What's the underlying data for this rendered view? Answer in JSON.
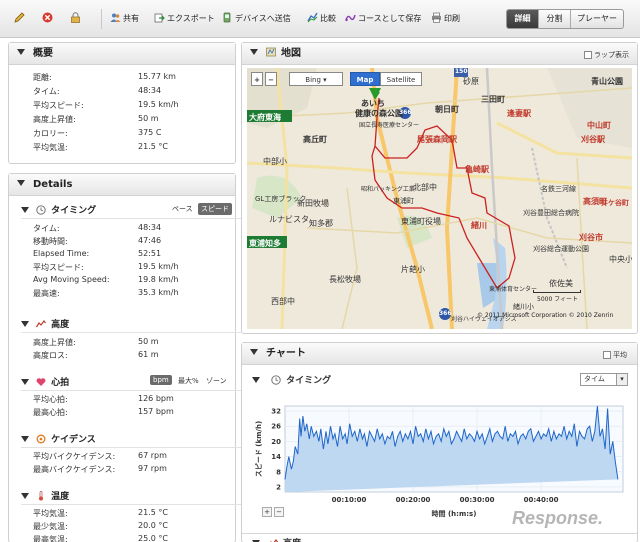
{
  "toolbar": {
    "items": [
      {
        "icon": "pencil-icon",
        "label": ""
      },
      {
        "icon": "delete-icon",
        "label": ""
      },
      {
        "icon": "lock-icon",
        "label": ""
      },
      {
        "icon": "people-icon",
        "label": "共有"
      },
      {
        "icon": "export-icon",
        "label": "エクスポート"
      },
      {
        "icon": "device-send-icon",
        "label": "デバイスへ送信"
      },
      {
        "icon": "compare-icon",
        "label": "比較"
      },
      {
        "icon": "course-save-icon",
        "label": "コースとして保存"
      },
      {
        "icon": "printer-icon",
        "label": "印刷"
      }
    ],
    "views": [
      "詳細",
      "分割",
      "プレーヤー"
    ],
    "active_view": "詳細"
  },
  "summary": {
    "title": "概要",
    "rows": [
      {
        "label": "距離:",
        "value": "15.77 km"
      },
      {
        "label": "タイム:",
        "value": "48:34"
      },
      {
        "label": "平均スピード:",
        "value": "19.5 km/h"
      },
      {
        "label": "高度上昇値:",
        "value": "50 m"
      },
      {
        "label": "カロリー:",
        "value": "375 C"
      },
      {
        "label": "平均気温:",
        "value": "21.5 °C"
      }
    ]
  },
  "details": {
    "title": "Details",
    "timing": {
      "title": "タイミング",
      "options": [
        "ペース",
        "スピード"
      ],
      "selected": "スピード",
      "rows": [
        {
          "label": "タイム:",
          "value": "48:34"
        },
        {
          "label": "移動時間:",
          "value": "47:46"
        },
        {
          "label": "Elapsed Time:",
          "value": "52:51"
        },
        {
          "label": "平均スピード:",
          "value": "19.5 km/h"
        },
        {
          "label": "Avg Moving Speed:",
          "value": "19.8 km/h"
        },
        {
          "label": "最高速:",
          "value": "35.3 km/h"
        }
      ]
    },
    "elevation": {
      "title": "高度",
      "rows": [
        {
          "label": "高度上昇値:",
          "value": "50 m"
        },
        {
          "label": "高度ロス:",
          "value": "61 m"
        }
      ]
    },
    "heart": {
      "title": "心拍",
      "options": [
        "bpm",
        "最大%",
        "ゾーン"
      ],
      "selected": "bpm",
      "rows": [
        {
          "label": "平均心拍:",
          "value": "126 bpm"
        },
        {
          "label": "最高心拍:",
          "value": "157 bpm"
        }
      ]
    },
    "cadence": {
      "title": "ケイデンス",
      "rows": [
        {
          "label": "平均バイクケイデンス:",
          "value": "67 rpm"
        },
        {
          "label": "最高バイクケイデンス:",
          "value": "97 rpm"
        }
      ]
    },
    "temperature": {
      "title": "温度",
      "rows": [
        {
          "label": "平均気温:",
          "value": "21.5 °C"
        },
        {
          "label": "最少気温:",
          "value": "20.0 °C"
        },
        {
          "label": "最高気温:",
          "value": "25.0 °C"
        }
      ]
    }
  },
  "map": {
    "title": "地図",
    "lap_display": "ラップ表示",
    "zoom_in": "+",
    "zoom_out": "−",
    "provider": "Bing",
    "types": [
      "Map",
      "Satellite"
    ],
    "active_type": "Map",
    "scale": "5000 フィート",
    "copyright": "© 2011 Microsoft Corporation   © 2010 Zenrin",
    "labels": [
      {
        "text": "大府東海",
        "color": "#1e7b34"
      },
      {
        "text": "東浦知多",
        "color": "#1e7b34"
      },
      {
        "text": "あいち",
        "color": "#333"
      },
      {
        "text": "健康の森公園",
        "color": "#333"
      },
      {
        "text": "国立長寿医療センター",
        "color": "#333"
      },
      {
        "text": "尾張森岡駅",
        "color": "#c0392b"
      },
      {
        "text": "亀崎駅",
        "color": "#c0392b"
      },
      {
        "text": "逢妻駅",
        "color": "#c0392b"
      },
      {
        "text": "刈谷駅",
        "color": "#c0392b"
      },
      {
        "text": "刈谷市",
        "color": "#c0392b"
      },
      {
        "text": "高須町",
        "color": "#c0392b"
      },
      {
        "text": "井ケ谷町",
        "color": "#c0392b"
      },
      {
        "text": "中山町",
        "color": "#c0392b"
      },
      {
        "text": "青山公園",
        "color": "#333"
      },
      {
        "text": "三田町",
        "color": "#333"
      },
      {
        "text": "砂原",
        "color": "#333"
      },
      {
        "text": "朝日町",
        "color": "#333"
      },
      {
        "text": "高丘町",
        "color": "#333"
      },
      {
        "text": "新田牧場",
        "color": "#333"
      },
      {
        "text": "昭和パッキング工業",
        "color": "#333"
      },
      {
        "text": "東浦町役場",
        "color": "#333"
      },
      {
        "text": "知多郡",
        "color": "#333"
      },
      {
        "text": "長松牧場",
        "color": "#333"
      },
      {
        "text": "西部中",
        "color": "#333"
      },
      {
        "text": "刈谷ハイウェイオアシス",
        "color": "#333"
      },
      {
        "text": "刈谷豊田総合病院",
        "color": "#333"
      },
      {
        "text": "東浦町",
        "color": "#333"
      },
      {
        "text": "緒川",
        "color": "#c0392b"
      },
      {
        "text": "北部中",
        "color": "#333"
      },
      {
        "text": "片葩小",
        "color": "#333"
      },
      {
        "text": "GL工房ブラック",
        "color": "#333"
      },
      {
        "text": "中部小",
        "color": "#333"
      },
      {
        "text": "刈谷総合運動公園",
        "color": "#333"
      },
      {
        "text": "名鉄三河線",
        "color": "#333"
      },
      {
        "text": "依佐美",
        "color": "#333"
      },
      {
        "text": "中央小",
        "color": "#333"
      },
      {
        "text": "東浦体育センター",
        "color": "#333"
      },
      {
        "text": "緒川小",
        "color": "#333"
      },
      {
        "text": "ルナビスタ",
        "color": "#333"
      }
    ],
    "road_numbers": [
      "150",
      "366",
      "366"
    ]
  },
  "chart": {
    "title": "チャート",
    "average_label": "平均",
    "section_title": "タイミング",
    "dropdown_value": "タイム",
    "bottom_section_title": "高度",
    "zoom_in": "+",
    "zoom_out": "−"
  },
  "watermark": "Response.",
  "chart_data": {
    "type": "area",
    "title": "",
    "xlabel": "時間 (h:m:s)",
    "ylabel": "スピード (km/h)",
    "x_ticks": [
      "00:10:00",
      "00:20:00",
      "00:30:00",
      "00:40:00"
    ],
    "y_ticks": [
      2,
      8,
      14,
      20,
      26,
      32
    ],
    "ylim": [
      0,
      34
    ],
    "xlim": [
      0,
      52.8
    ],
    "fill_color": "#bfd8f2",
    "line_color": "#1f66c9",
    "x": [
      0,
      0.3,
      0.6,
      1.0,
      1.3,
      1.6,
      2.0,
      2.3,
      2.5,
      2.8,
      3.1,
      3.4,
      3.8,
      4.1,
      4.5,
      4.9,
      5.3,
      5.6,
      6.0,
      6.4,
      6.7,
      7.1,
      7.5,
      7.8,
      8.2,
      8.6,
      9.0,
      9.4,
      9.7,
      10.1,
      10.5,
      10.9,
      11.3,
      11.7,
      12.1,
      12.4,
      12.8,
      13.2,
      13.6,
      14.0,
      14.4,
      14.8,
      15.2,
      15.6,
      16.0,
      16.4,
      16.8,
      17.2,
      17.6,
      18.0,
      18.4,
      18.8,
      19.2,
      19.6,
      20.0,
      20.4,
      20.8,
      21.2,
      21.6,
      22.0,
      22.4,
      22.8,
      23.2,
      23.6,
      24.0,
      24.4,
      24.8,
      25.2,
      25.6,
      26.0,
      26.4,
      26.8,
      27.2,
      27.6,
      28.0,
      28.4,
      28.8,
      29.2,
      29.6,
      30.0,
      30.4,
      30.8,
      31.2,
      31.6,
      32.0,
      32.4,
      32.8,
      33.2,
      33.6,
      34.0,
      34.4,
      34.8,
      35.2,
      35.6,
      36.0,
      36.4,
      36.8,
      37.2,
      37.6,
      38.0,
      38.4,
      38.8,
      39.2,
      39.6,
      40.0,
      40.4,
      40.8,
      41.2,
      41.6,
      42.0,
      42.4,
      42.8,
      43.2,
      43.6,
      44.0,
      44.4,
      44.8,
      45.2,
      45.6,
      46.0,
      46.4,
      46.8,
      47.2,
      47.6,
      48.0,
      48.4,
      48.8,
      49.2,
      49.6,
      50.0,
      50.4,
      50.8,
      51.2,
      51.6,
      52.0,
      52.4,
      52.8
    ],
    "values": [
      5,
      10,
      14,
      9,
      12,
      18,
      15,
      29,
      22,
      30,
      24,
      27,
      21,
      26,
      22,
      24,
      20,
      25,
      17,
      24,
      19,
      26,
      21,
      23,
      18,
      26,
      21,
      23,
      19,
      27,
      22,
      24,
      20,
      25,
      21,
      23,
      18,
      24,
      22,
      20,
      25,
      21,
      23,
      19,
      22,
      21,
      24,
      18,
      22,
      24,
      20,
      23,
      21,
      24,
      19,
      26,
      22,
      23,
      20,
      25,
      21,
      24,
      19,
      22,
      23,
      20,
      25,
      22,
      24,
      19,
      21,
      24,
      22,
      20,
      25,
      21,
      23,
      22,
      20,
      24,
      21,
      23,
      19,
      22,
      25,
      20,
      23,
      24,
      22,
      21,
      26,
      20,
      23,
      22,
      24,
      19,
      22,
      23,
      21,
      24,
      25,
      20,
      22,
      24,
      21,
      23,
      22,
      25,
      20,
      24,
      21,
      23,
      22,
      26,
      21,
      24,
      22,
      27,
      18,
      24,
      22,
      21,
      25,
      26,
      20,
      24,
      34,
      22,
      25,
      17,
      33,
      15,
      20,
      12,
      5
    ]
  }
}
